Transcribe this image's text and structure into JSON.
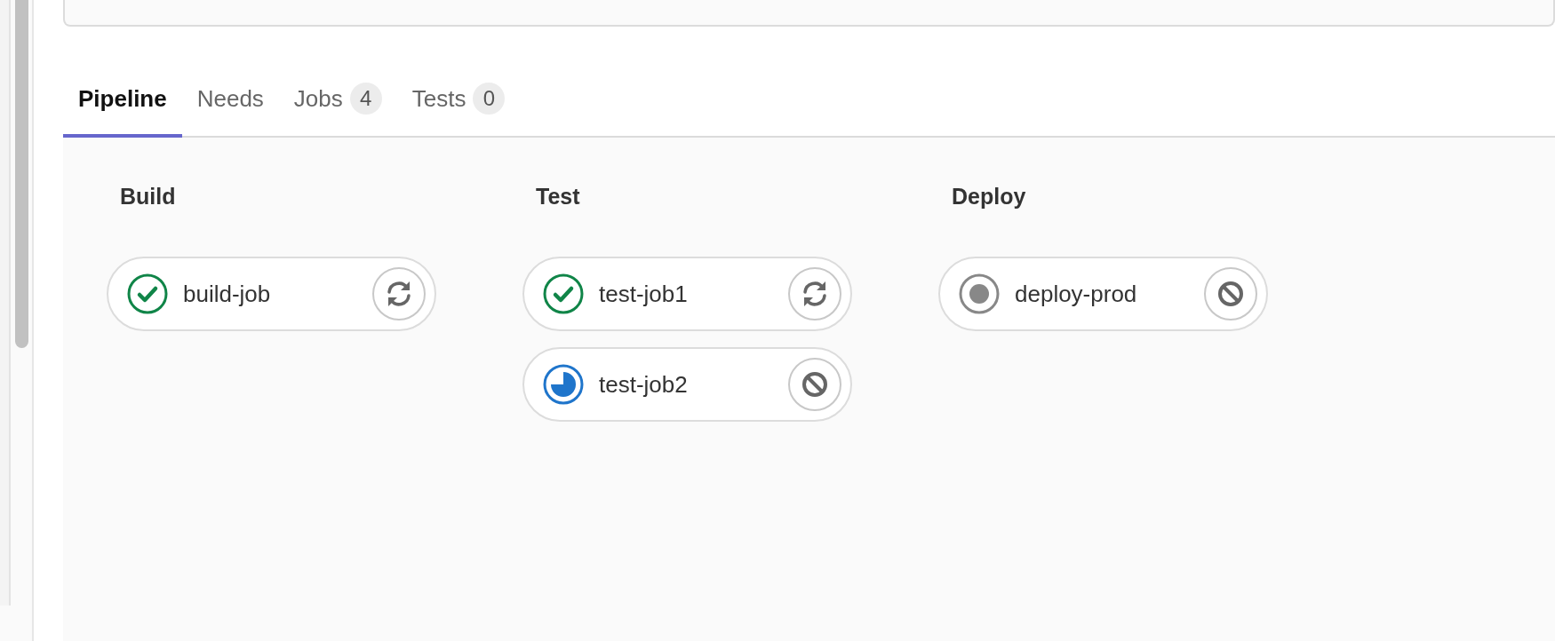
{
  "tabs": [
    {
      "label": "Pipeline",
      "selected": true
    },
    {
      "label": "Needs",
      "selected": false
    },
    {
      "label": "Jobs",
      "count": "4",
      "selected": false
    },
    {
      "label": "Tests",
      "count": "0",
      "selected": false
    }
  ],
  "stages": [
    {
      "title": "Build",
      "jobs": [
        {
          "name": "build-job",
          "kind": "success",
          "action": {
            "kind": "retry"
          }
        }
      ]
    },
    {
      "title": "Test",
      "jobs": [
        {
          "name": "test-job1",
          "kind": "success",
          "action": {
            "kind": "retry"
          }
        },
        {
          "name": "test-job2",
          "kind": "running",
          "action": {
            "kind": "cancel"
          }
        }
      ]
    },
    {
      "title": "Deploy",
      "jobs": [
        {
          "name": "deploy-prod",
          "kind": "created",
          "action": {
            "kind": "cancel"
          }
        }
      ]
    }
  ]
}
